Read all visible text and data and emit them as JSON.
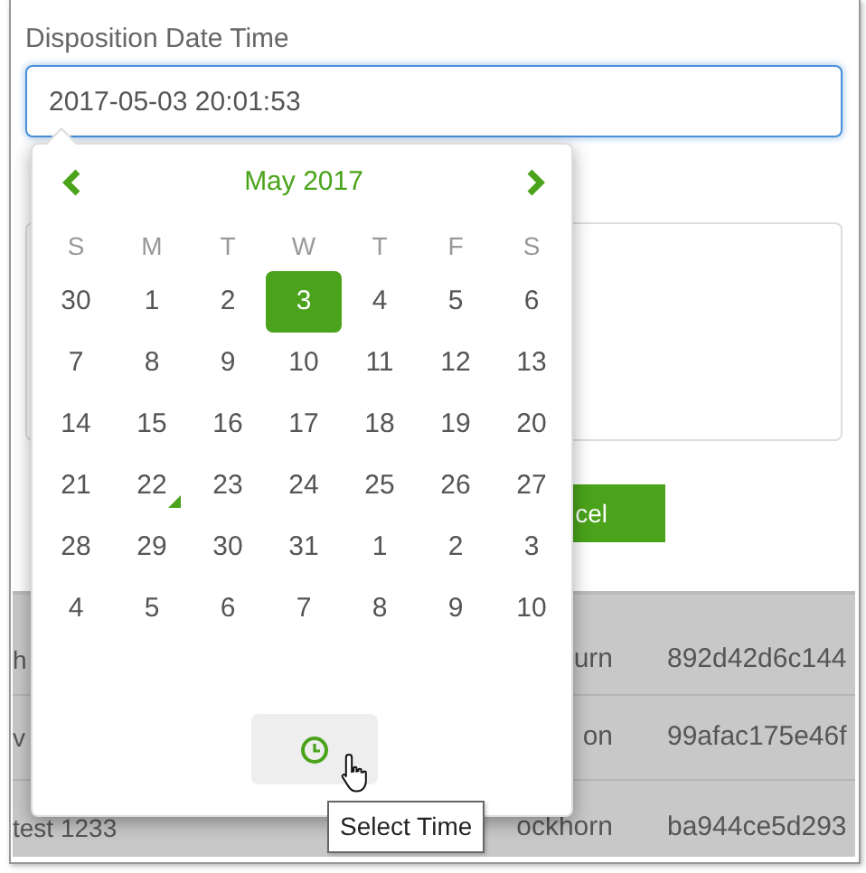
{
  "field": {
    "label": "Disposition Date Time",
    "value": "2017-05-03 20:01:53"
  },
  "cancel_button": {
    "label": "cel"
  },
  "table": {
    "rows": [
      [
        "h",
        "urn",
        "892d42d6c144"
      ],
      [
        "v",
        "on",
        "99afac175e46f"
      ],
      [
        "test 1233",
        "ockhorn",
        "ba944ce5d293"
      ]
    ]
  },
  "datepicker": {
    "month": "May 2017",
    "weekdays": [
      "S",
      "M",
      "T",
      "W",
      "T",
      "F",
      "S"
    ],
    "weeks": [
      [
        {
          "day": "30",
          "selected": false,
          "today": false
        },
        {
          "day": "1",
          "selected": false,
          "today": false
        },
        {
          "day": "2",
          "selected": false,
          "today": false
        },
        {
          "day": "3",
          "selected": true,
          "today": false
        },
        {
          "day": "4",
          "selected": false,
          "today": false
        },
        {
          "day": "5",
          "selected": false,
          "today": false
        },
        {
          "day": "6",
          "selected": false,
          "today": false
        }
      ],
      [
        {
          "day": "7",
          "selected": false,
          "today": false
        },
        {
          "day": "8",
          "selected": false,
          "today": false
        },
        {
          "day": "9",
          "selected": false,
          "today": false
        },
        {
          "day": "10",
          "selected": false,
          "today": false
        },
        {
          "day": "11",
          "selected": false,
          "today": false
        },
        {
          "day": "12",
          "selected": false,
          "today": false
        },
        {
          "day": "13",
          "selected": false,
          "today": false
        }
      ],
      [
        {
          "day": "14",
          "selected": false,
          "today": false
        },
        {
          "day": "15",
          "selected": false,
          "today": false
        },
        {
          "day": "16",
          "selected": false,
          "today": false
        },
        {
          "day": "17",
          "selected": false,
          "today": false
        },
        {
          "day": "18",
          "selected": false,
          "today": false
        },
        {
          "day": "19",
          "selected": false,
          "today": false
        },
        {
          "day": "20",
          "selected": false,
          "today": false
        }
      ],
      [
        {
          "day": "21",
          "selected": false,
          "today": false
        },
        {
          "day": "22",
          "selected": false,
          "today": true
        },
        {
          "day": "23",
          "selected": false,
          "today": false
        },
        {
          "day": "24",
          "selected": false,
          "today": false
        },
        {
          "day": "25",
          "selected": false,
          "today": false
        },
        {
          "day": "26",
          "selected": false,
          "today": false
        },
        {
          "day": "27",
          "selected": false,
          "today": false
        }
      ],
      [
        {
          "day": "28",
          "selected": false,
          "today": false
        },
        {
          "day": "29",
          "selected": false,
          "today": false
        },
        {
          "day": "30",
          "selected": false,
          "today": false
        },
        {
          "day": "31",
          "selected": false,
          "today": false
        },
        {
          "day": "1",
          "selected": false,
          "today": false
        },
        {
          "day": "2",
          "selected": false,
          "today": false
        },
        {
          "day": "3",
          "selected": false,
          "today": false
        }
      ],
      [
        {
          "day": "4",
          "selected": false,
          "today": false
        },
        {
          "day": "5",
          "selected": false,
          "today": false
        },
        {
          "day": "6",
          "selected": false,
          "today": false
        },
        {
          "day": "7",
          "selected": false,
          "today": false
        },
        {
          "day": "8",
          "selected": false,
          "today": false
        },
        {
          "day": "9",
          "selected": false,
          "today": false
        },
        {
          "day": "10",
          "selected": false,
          "today": false
        }
      ]
    ]
  },
  "tooltip": "Select Time"
}
